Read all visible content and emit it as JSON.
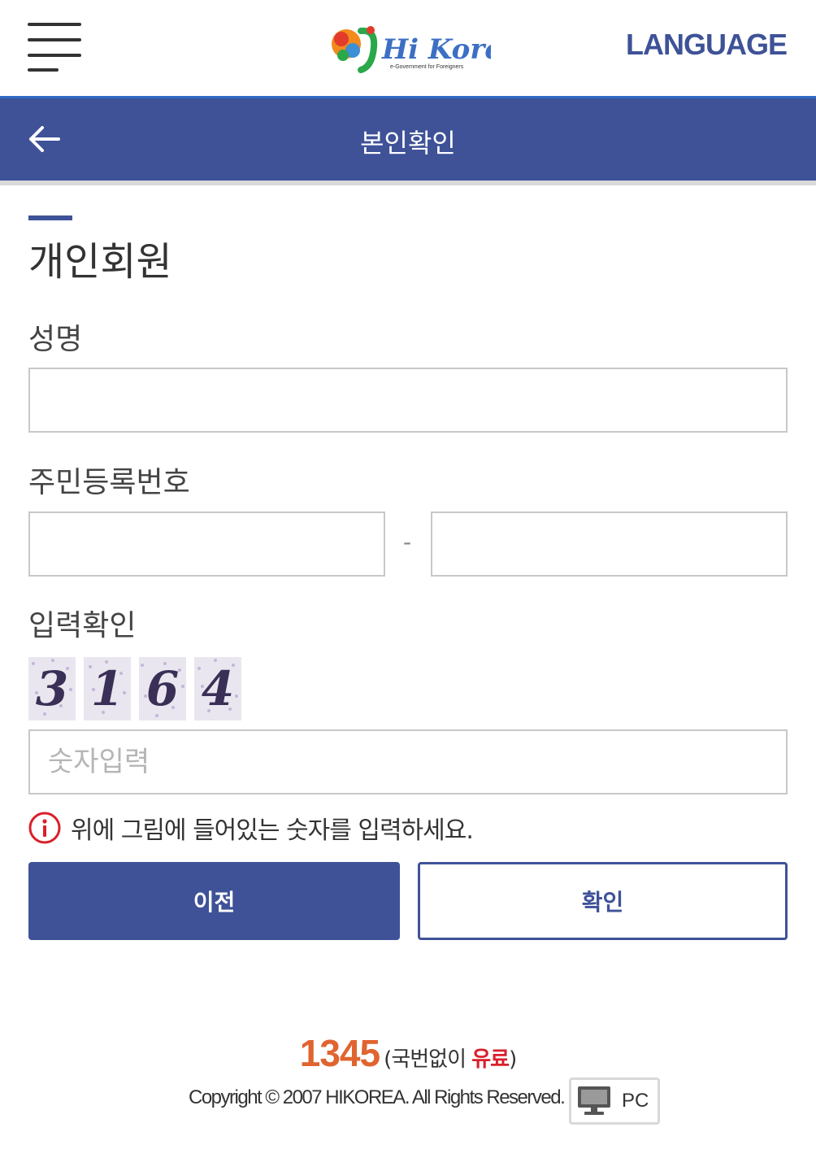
{
  "header": {
    "menu_icon": "hamburger-menu-icon",
    "logo_text": "Hi Korea",
    "logo_subtext": "e-Government for Foreigners",
    "language_label": "LANGUAGE"
  },
  "titlebar": {
    "back_icon": "arrow-left-icon",
    "title": "본인확인"
  },
  "form": {
    "section_title": "개인회원",
    "name_label": "성명",
    "name_value": "",
    "rrn_label": "주민등록번호",
    "rrn_first_value": "",
    "rrn_separator": "-",
    "rrn_second_value": "",
    "captcha_label": "입력확인",
    "captcha_digits": [
      "3",
      "1",
      "6",
      "4"
    ],
    "captcha_placeholder": "숫자입력",
    "captcha_value": "",
    "notice_icon": "info-circle-icon",
    "notice_text": "위에 그림에 들어있는 숫자를 입력하세요.",
    "prev_button": "이전",
    "confirm_button": "확인"
  },
  "footer": {
    "phone_number": "1345",
    "phone_note_open": "(국번없이 ",
    "phone_note_paid": "유료",
    "phone_note_close": ")",
    "copyright": "Copyright © 2007 HIKOREA. All Rights Reserved.",
    "pc_button": "PC",
    "pc_icon": "monitor-icon"
  },
  "colors": {
    "primary": "#3f5298",
    "phone_orange": "#e06430",
    "alert_red": "#d8202b"
  }
}
